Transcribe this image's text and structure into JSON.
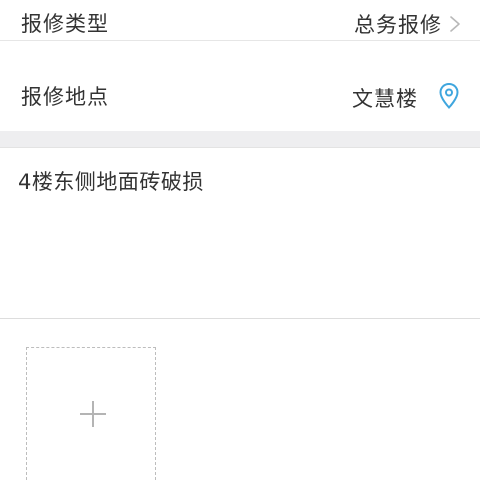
{
  "form": {
    "repair_type": {
      "label": "报修类型",
      "value": "总务报修",
      "icon": "chevron-right-icon"
    },
    "repair_location": {
      "label": "报修地点",
      "value": "文慧楼",
      "icon": "location-pin-icon",
      "icon_color": "#3fa6de"
    },
    "description": {
      "value": "4楼东侧地面砖破损"
    },
    "upload": {
      "icon": "plus-icon"
    }
  },
  "colors": {
    "section_gap": "#eeeef0",
    "divider": "#e6e6e6",
    "text": "#333333"
  }
}
